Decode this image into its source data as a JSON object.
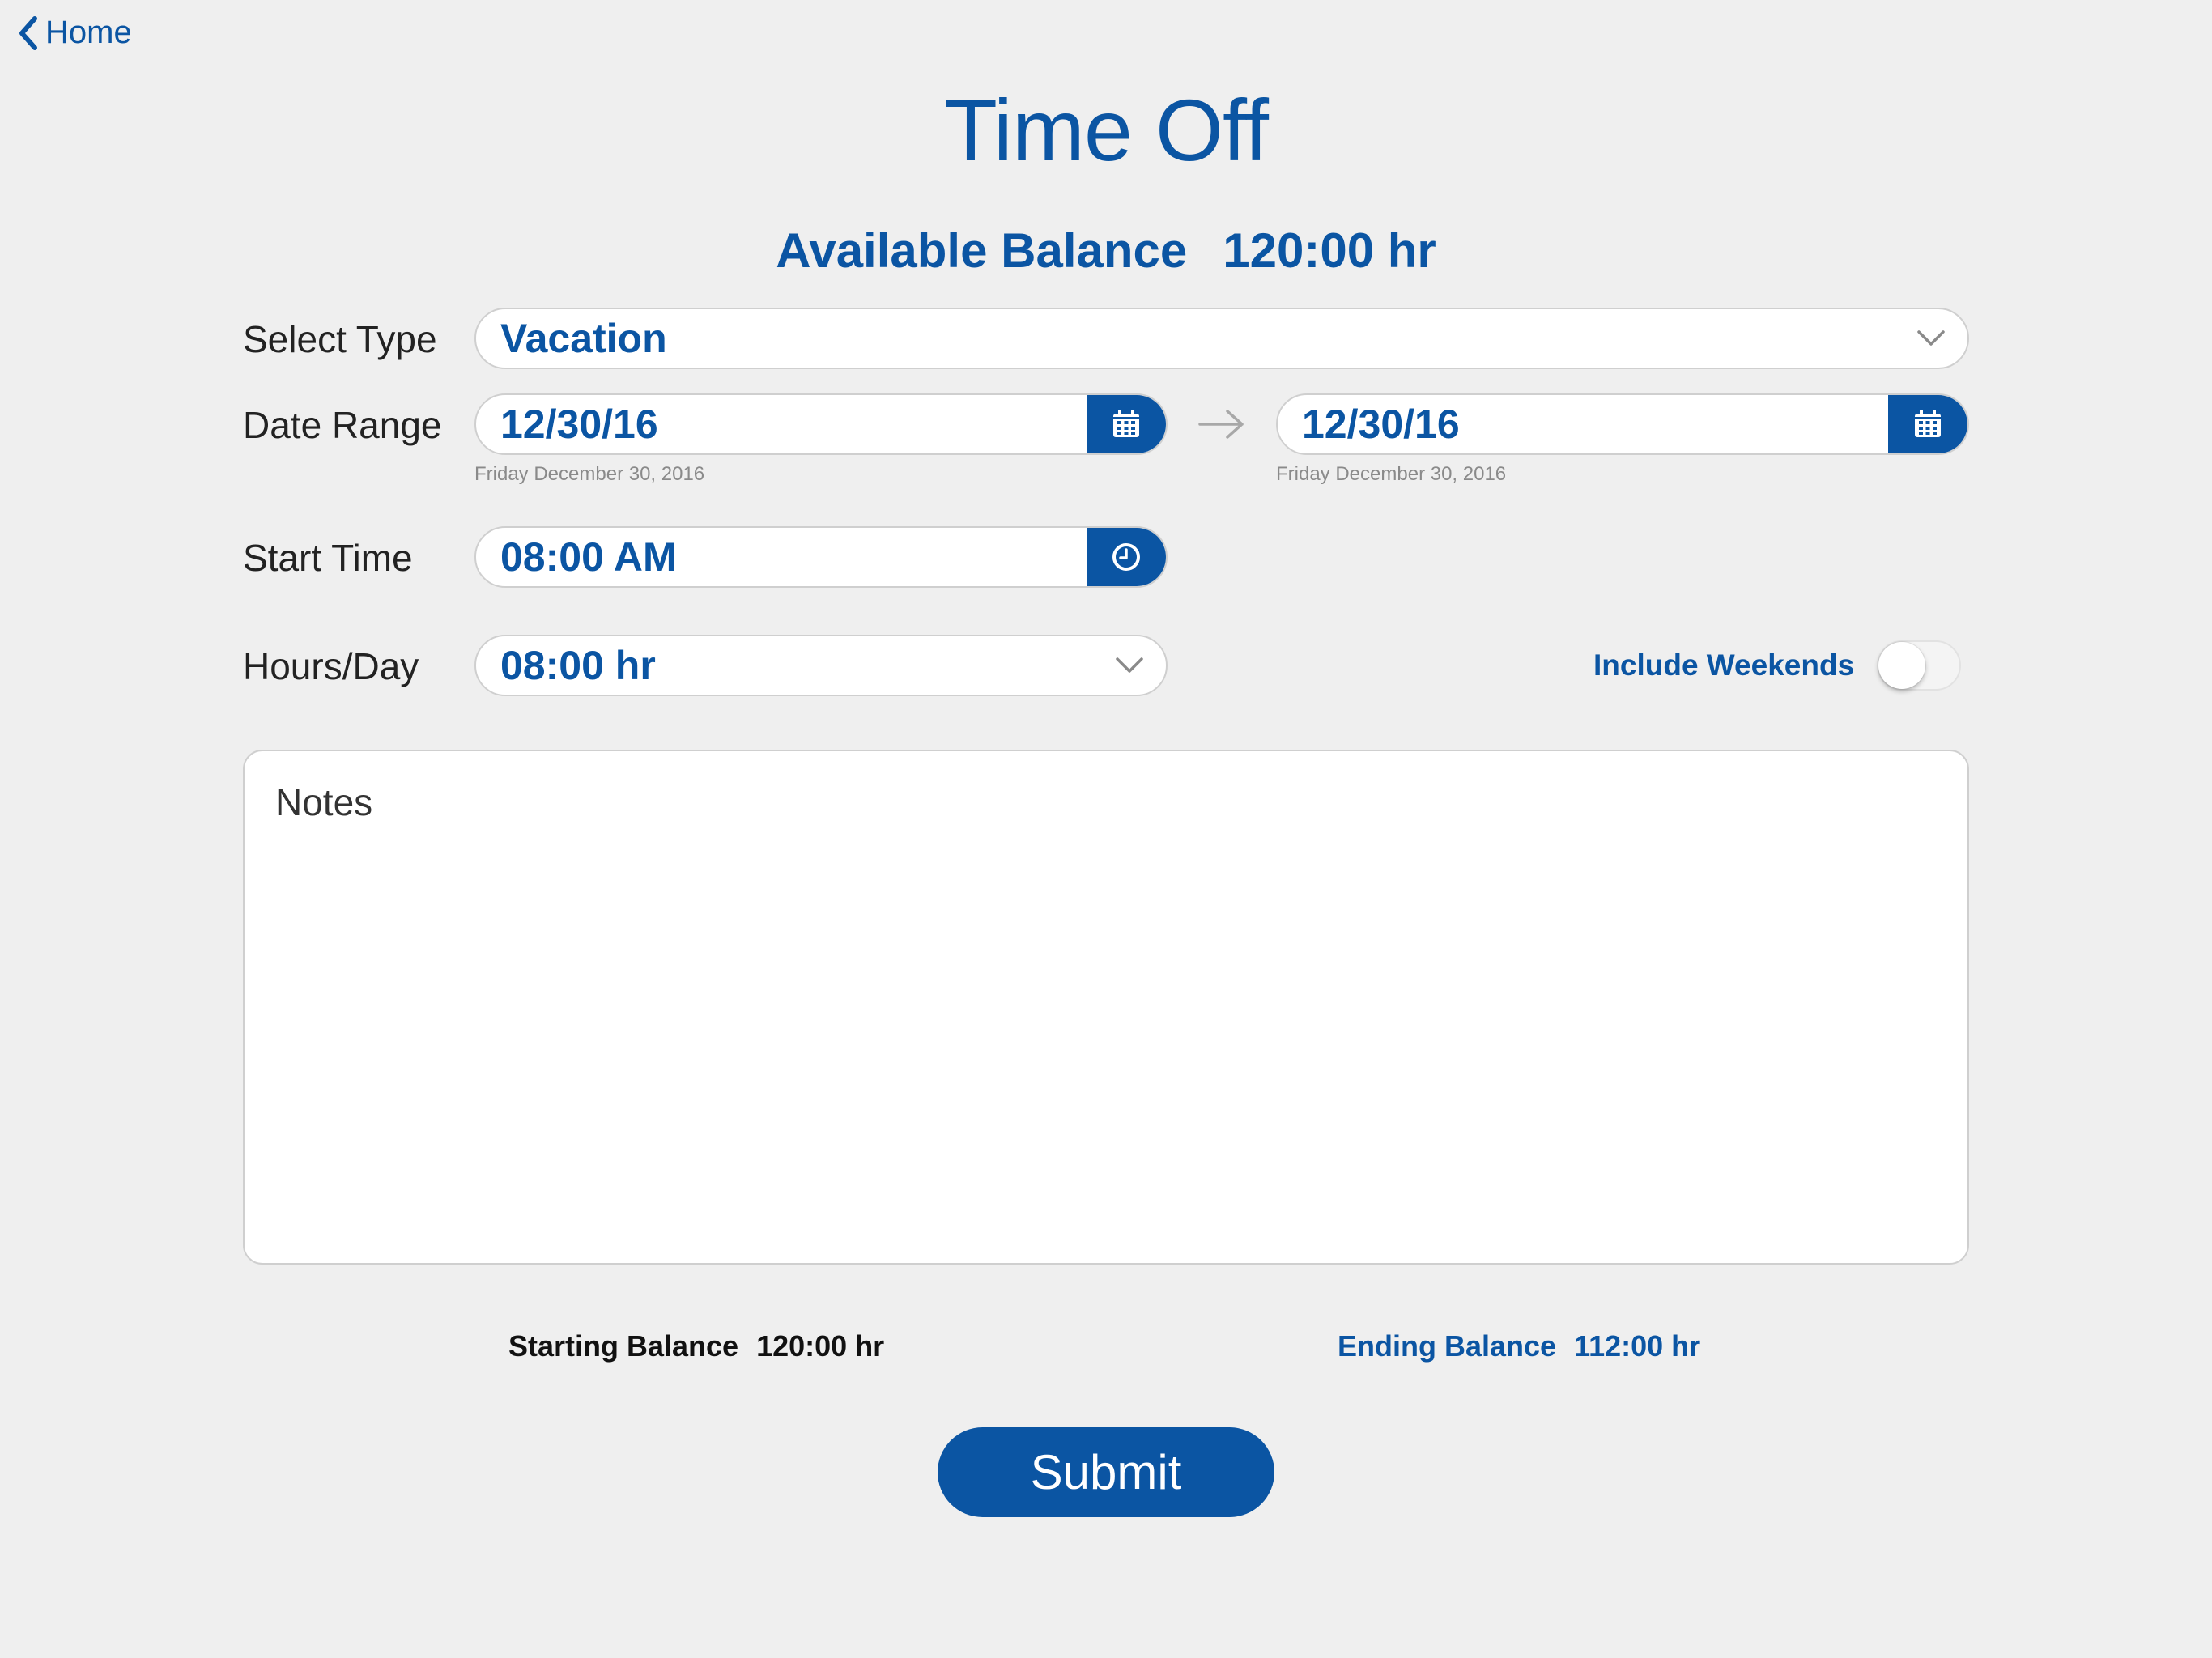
{
  "nav": {
    "back_label": "Home"
  },
  "page": {
    "title": "Time Off"
  },
  "available": {
    "label": "Available Balance",
    "value": "120:00 hr"
  },
  "form": {
    "select_type": {
      "label": "Select Type",
      "value": "Vacation"
    },
    "date_range": {
      "label": "Date Range",
      "start": {
        "value": "12/30/16",
        "subtext": "Friday December 30, 2016"
      },
      "end": {
        "value": "12/30/16",
        "subtext": "Friday December 30, 2016"
      }
    },
    "start_time": {
      "label": "Start Time",
      "value": "08:00 AM"
    },
    "hours_per_day": {
      "label": "Hours/Day",
      "value": "08:00 hr"
    },
    "include_weekends": {
      "label": "Include Weekends",
      "enabled": false
    },
    "notes": {
      "placeholder": "Notes"
    }
  },
  "balances": {
    "starting": {
      "label": "Starting Balance",
      "value": "120:00 hr"
    },
    "ending": {
      "label": "Ending Balance",
      "value": "112:00 hr"
    }
  },
  "actions": {
    "submit_label": "Submit"
  },
  "colors": {
    "accent": "#0b55a3",
    "background": "#efefef",
    "field_border": "#cfcfcf",
    "muted_text": "#8a8a8a"
  },
  "icons": {
    "back": "chevron-left-icon",
    "dropdown": "chevron-down-icon",
    "date_picker": "calendar-icon",
    "time_picker": "clock-icon",
    "range_separator": "arrow-right-icon"
  }
}
